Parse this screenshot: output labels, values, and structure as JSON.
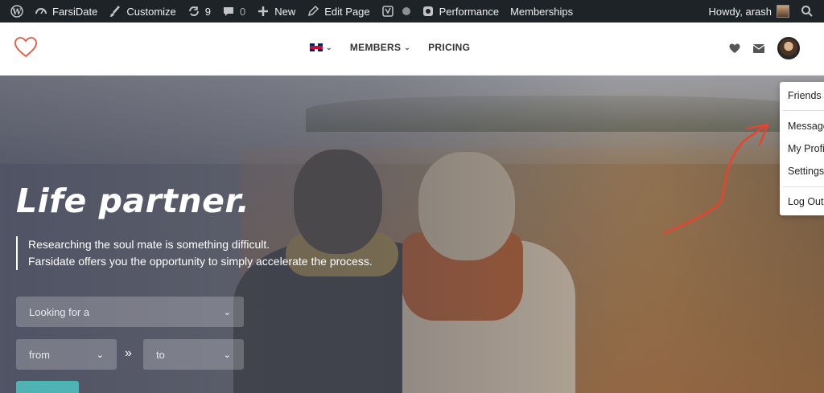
{
  "adminbar": {
    "site_name": "FarsiDate",
    "customize": "Customize",
    "updates_count": "9",
    "comments_count": "0",
    "new_label": "New",
    "edit_page": "Edit Page",
    "performance": "Performance",
    "memberships": "Memberships",
    "greeting": "Howdy, arash"
  },
  "header": {
    "logo_icon": "heart-outline-icon",
    "nav": {
      "members": "MEMBERS",
      "pricing": "PRICING"
    },
    "accent": "#e8543c"
  },
  "hero": {
    "title": "Life partner.",
    "subtitle_line1": "Researching the soul mate is something difficult.",
    "subtitle_line2": "Farsidate offers you the opportunity to simply accelerate the process.",
    "looking_for_placeholder": "Looking for a",
    "from_placeholder": "from",
    "to_placeholder": "to",
    "separator": "»",
    "button_color": "#4fb3b4"
  },
  "dropdown": {
    "friends": "Friends",
    "messages": "Messages",
    "my_profile": "My Profile",
    "settings": "Settings",
    "log_out": "Log Out"
  },
  "annotation": {
    "arrow_color": "#e8432f"
  }
}
